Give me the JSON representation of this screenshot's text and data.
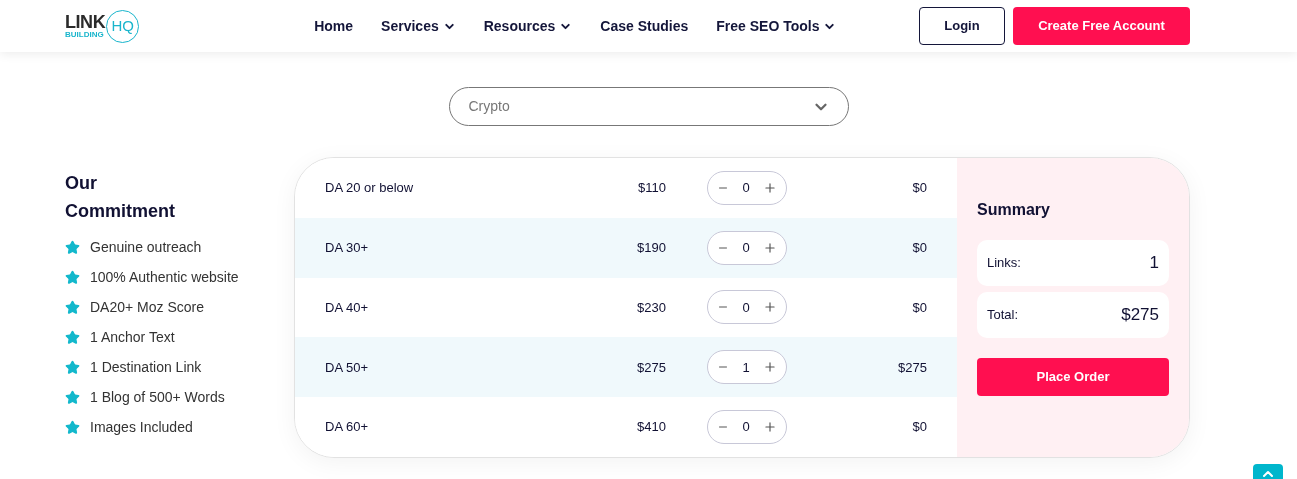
{
  "header": {
    "logo": {
      "word": "LINK",
      "sub": "BUILDING",
      "badge": "HQ"
    },
    "nav": [
      {
        "label": "Home",
        "has_menu": false
      },
      {
        "label": "Services",
        "has_menu": true
      },
      {
        "label": "Resources",
        "has_menu": true
      },
      {
        "label": "Case Studies",
        "has_menu": false
      },
      {
        "label": "Free SEO Tools",
        "has_menu": true
      }
    ],
    "login": "Login",
    "signup": "Create Free Account"
  },
  "industry_select": {
    "value": "Crypto"
  },
  "commitment": {
    "title": "Our Commitment",
    "items": [
      "Genuine outreach",
      "100% Authentic website",
      "DA20+ Moz Score",
      "1 Anchor Text",
      "1 Destination Link",
      "1 Blog of 500+ Words",
      "Images Included"
    ]
  },
  "packages": [
    {
      "name": "DA 20 or below",
      "price": "$110",
      "quantity": "0",
      "subtotal": "$0"
    },
    {
      "name": "DA 30+",
      "price": "$190",
      "quantity": "0",
      "subtotal": "$0"
    },
    {
      "name": "DA 40+",
      "price": "$230",
      "quantity": "0",
      "subtotal": "$0"
    },
    {
      "name": "DA 50+",
      "price": "$275",
      "quantity": "1",
      "subtotal": "$275"
    },
    {
      "name": "DA 60+",
      "price": "$410",
      "quantity": "0",
      "subtotal": "$0"
    }
  ],
  "summary": {
    "title": "Summary",
    "rows": [
      {
        "label": "Links:",
        "value": "1"
      },
      {
        "label": "Total:",
        "value": "$275"
      }
    ],
    "button": "Place Order"
  }
}
